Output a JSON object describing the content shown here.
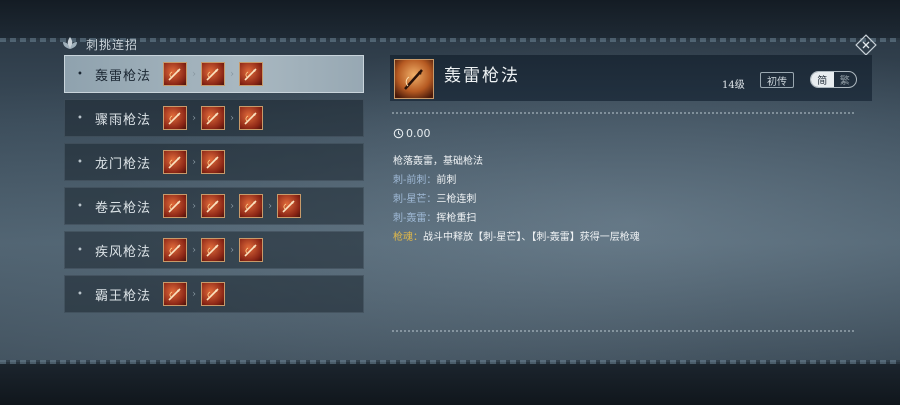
{
  "header": {
    "title": "刺挑连招"
  },
  "combos": [
    {
      "name": "轰雷枪法",
      "icon_count": 3,
      "selected": true
    },
    {
      "name": "骤雨枪法",
      "icon_count": 3,
      "selected": false
    },
    {
      "name": "龙门枪法",
      "icon_count": 2,
      "selected": false
    },
    {
      "name": "卷云枪法",
      "icon_count": 4,
      "selected": false
    },
    {
      "name": "疾风枪法",
      "icon_count": 3,
      "selected": false
    },
    {
      "name": "霸王枪法",
      "icon_count": 2,
      "selected": false
    }
  ],
  "detail": {
    "title": "轰雷枪法",
    "level": "14级",
    "rank": "初传",
    "toggle": {
      "simple": "简",
      "detailed": "繁",
      "active": "simple"
    },
    "cooldown": "0.00",
    "description": {
      "intro": "枪落轰雷，基础枪法",
      "lines": [
        {
          "label": "刺-前刺：",
          "text": "前刺"
        },
        {
          "label": "刺-星芒：",
          "text": "三枪连刺"
        },
        {
          "label": "刺-轰雷：",
          "text": "挥枪重扫"
        }
      ],
      "soul": {
        "label": "枪魂：",
        "text": "战斗中释放【刺-星芒】、【刺-轰雷】获得一层枪魂"
      }
    }
  },
  "icons": {
    "header": "lotus-emblem-icon",
    "close": "close-diamond-icon",
    "skill": "spear-skill-icon",
    "cooldown": "clock-icon"
  },
  "colors": {
    "selected_row": "#a9b8c1",
    "label_blue": "#9fb9d6",
    "soul_gold": "#e0b84a",
    "icon_border": "#c89a6a"
  }
}
